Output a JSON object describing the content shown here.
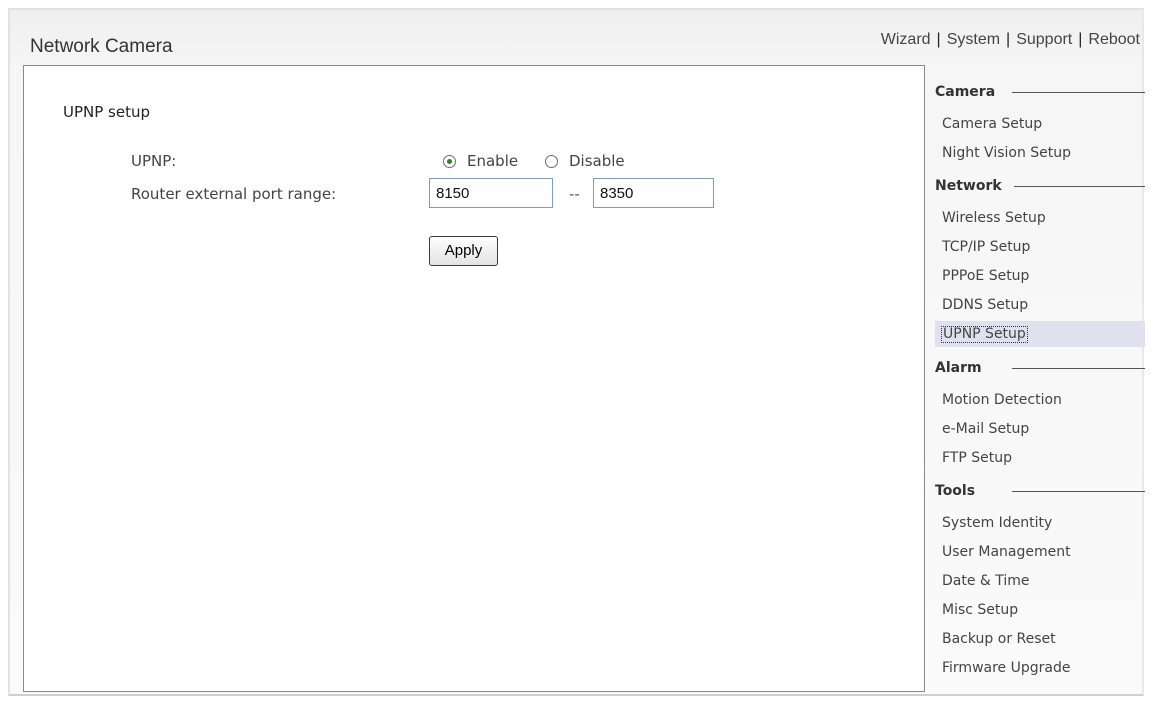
{
  "header": {
    "title": "Network Camera",
    "nav": [
      "Wizard",
      "System",
      "Support",
      "Reboot"
    ]
  },
  "main": {
    "heading": "UPNP setup",
    "upnp_label": "UPNP:",
    "enable_label": "Enable",
    "disable_label": "Disable",
    "upnp_selected": "Enable",
    "port_label": "Router external port range:",
    "port_from": "8150",
    "port_separator": "--",
    "port_to": "8350",
    "apply_label": "Apply"
  },
  "sidebar": {
    "sections": [
      {
        "title": "Camera",
        "items": [
          "Camera Setup",
          "Night Vision Setup"
        ]
      },
      {
        "title": "Network",
        "items": [
          "Wireless Setup",
          "TCP/IP Setup",
          "PPPoE Setup",
          "DDNS Setup",
          "UPNP Setup"
        ]
      },
      {
        "title": "Alarm",
        "items": [
          "Motion Detection",
          "e-Mail Setup",
          "FTP Setup"
        ]
      },
      {
        "title": "Tools",
        "items": [
          "System Identity",
          "User Management",
          "Date & Time",
          "Misc Setup",
          "Backup or Reset",
          "Firmware Upgrade"
        ]
      }
    ],
    "selected_item": "UPNP Setup"
  },
  "colors": {
    "selected_bg": "#dfe2ee",
    "content_border": "#8a8a8a",
    "radio_dot": "#2e7d2e"
  }
}
